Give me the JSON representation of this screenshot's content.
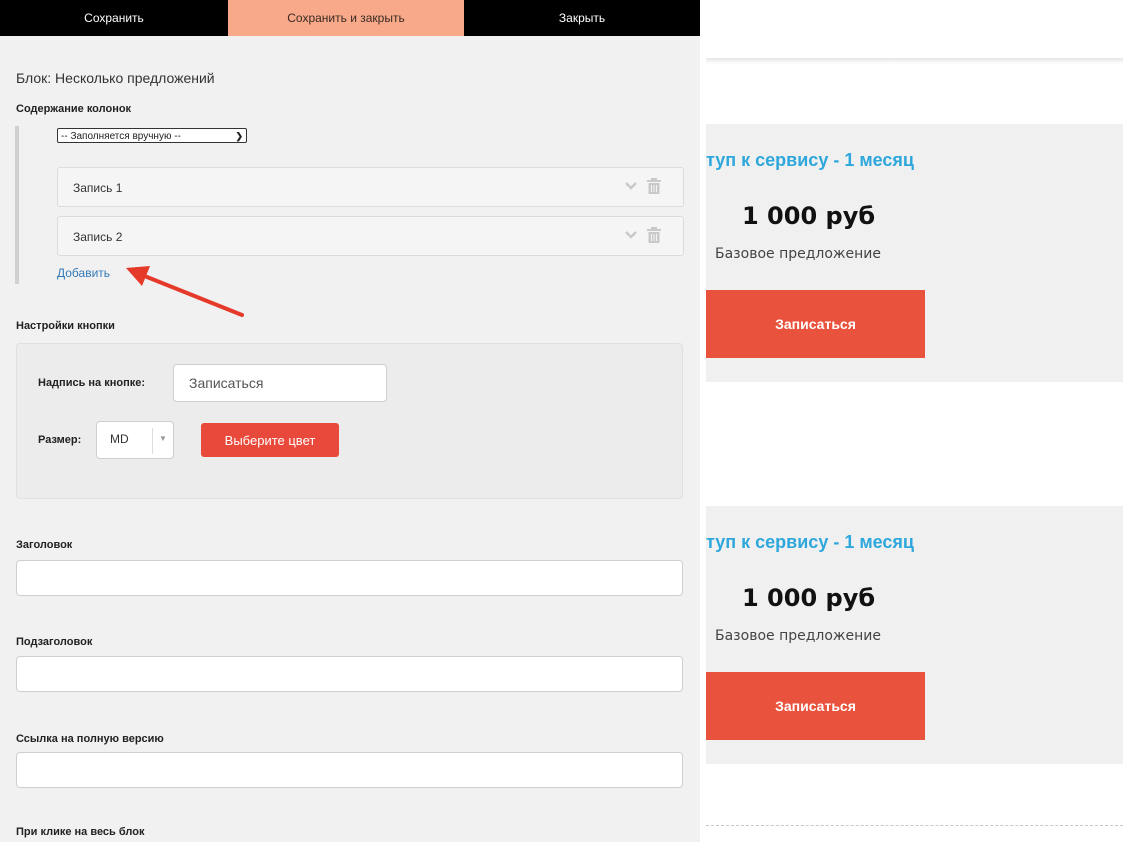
{
  "toolbar": {
    "save": "Сохранить",
    "save_close": "Сохранить и закрыть",
    "close": "Закрыть"
  },
  "editor": {
    "block_title": "Блок: Несколько предложений",
    "columns_label": "Содержание колонок",
    "fill_mode": "-- Заполняется вручную --",
    "records": [
      {
        "label": "Запись 1"
      },
      {
        "label": "Запись 2"
      }
    ],
    "add_link": "Добавить",
    "button_settings_label": "Настройки кнопки",
    "caption_label": "Надпись на кнопке:",
    "caption_value": "Записаться",
    "size_label": "Размер:",
    "size_value": "MD",
    "color_button": "Выберите цвет",
    "heading_label": "Заголовок",
    "subheading_label": "Подзаголовок",
    "full_link_label": "Ссылка на полную версию",
    "click_label": "При клике на весь блок"
  },
  "preview": {
    "cards": [
      {
        "title": "туп к сервису - 1 месяц",
        "price": "1 000 руб",
        "subtitle": "Базовое предложение",
        "button": "Записаться"
      },
      {
        "title": "туп к сервису - 1 месяц",
        "price": "1 000 руб",
        "subtitle": "Базовое предложение",
        "button": "Записаться"
      }
    ]
  },
  "colors": {
    "accent": "#e9523c",
    "link": "#2ea7dc",
    "toolbar_bg": "#000000",
    "toolbar_active": "#f7a98a"
  }
}
